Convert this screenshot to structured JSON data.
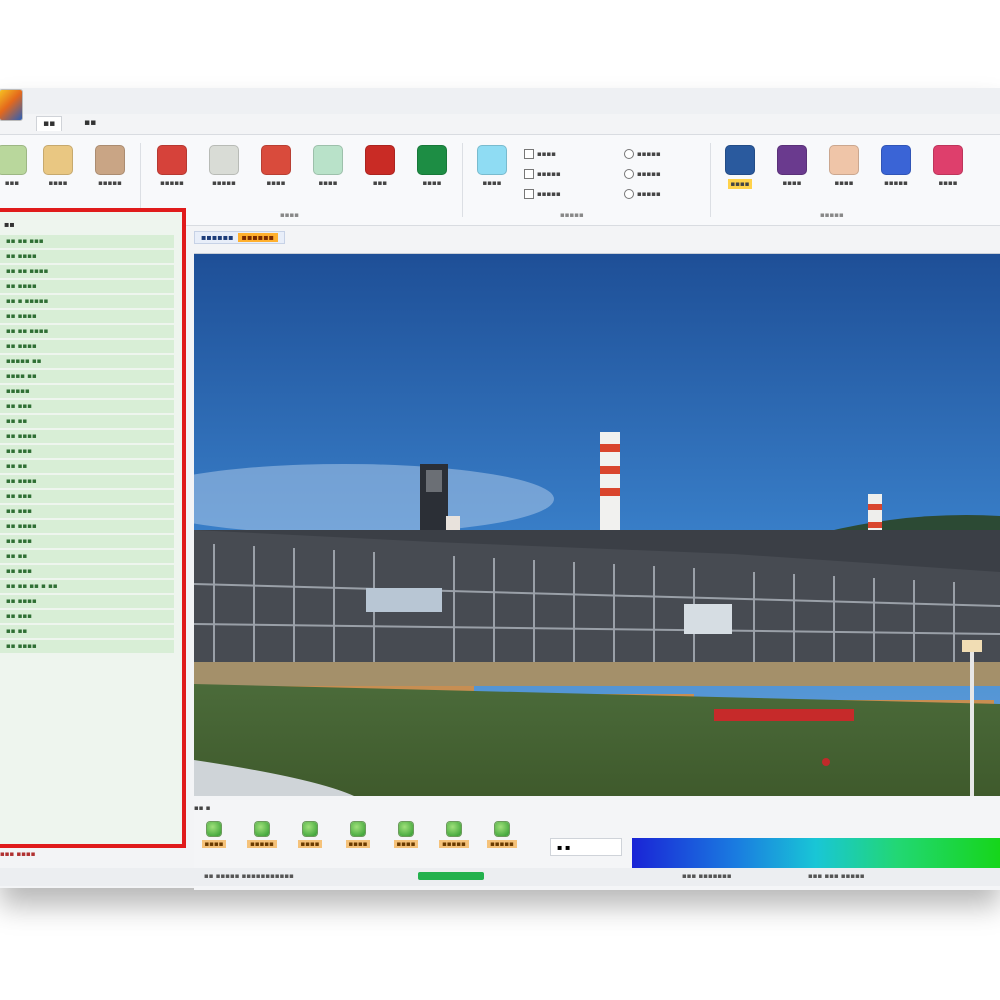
{
  "app": {
    "menu_tabs": [
      {
        "label": "▪▪"
      },
      {
        "label": "▪▪"
      }
    ]
  },
  "ribbon": {
    "buttons": [
      {
        "label": "▪▪▪",
        "color": "#b9d79c",
        "icon": "layer-icon"
      },
      {
        "label": "▪▪▪▪",
        "color": "#e9c782",
        "icon": "image-icon"
      },
      {
        "label": "▪▪▪▪▪",
        "color": "#c9a585",
        "icon": "texture-icon"
      },
      {
        "label": "▪▪▪▪▪",
        "color": "#d6423a",
        "icon": "record-icon"
      },
      {
        "label": "▪▪▪▪▪",
        "color": "#d9dcd6",
        "icon": "pointer-icon"
      },
      {
        "label": "▪▪▪▪",
        "color": "#d94b3c",
        "icon": "video-icon"
      },
      {
        "label": "▪▪▪▪",
        "color": "#b9e2c9",
        "icon": "mask-icon"
      },
      {
        "label": "▪▪▪",
        "color": "#c92b25",
        "icon": "shield-icon"
      },
      {
        "label": "▪▪▪▪",
        "color": "#1d8d44",
        "icon": "refresh-icon"
      },
      {
        "label": "▪▪▪▪",
        "color": "#8fdcf3",
        "icon": "screen-icon"
      }
    ],
    "buttons_right": [
      {
        "label": "▪▪▪▪",
        "color": "#2a5a9e",
        "icon": "search-icon",
        "highlight": true
      },
      {
        "label": "▪▪▪▪",
        "color": "#6a3a8e",
        "icon": "user-icon"
      },
      {
        "label": "▪▪▪▪",
        "color": "#efc5a8",
        "icon": "palette-icon"
      },
      {
        "label": "▪▪▪▪▪",
        "color": "#3a64d6",
        "icon": "square-icon"
      },
      {
        "label": "▪▪▪▪",
        "color": "#de3f6c",
        "icon": "grid-icon"
      }
    ],
    "options": [
      {
        "label": "▪▪▪▪"
      },
      {
        "label": "▪▪▪▪▪"
      },
      {
        "label": "▪▪▪▪▪"
      },
      {
        "label": "▪▪▪▪▪"
      },
      {
        "label": "▪▪▪▪▪"
      },
      {
        "label": "▪▪▪▪▪"
      }
    ],
    "group_labels": [
      "▪▪▪▪",
      "▪▪▪▪▪",
      "▪▪▪▪▪"
    ]
  },
  "tree": {
    "root": "▪▪",
    "items": [
      "▪▪ ▪▪ ▪▪▪",
      "▪▪ ▪▪▪▪",
      "▪▪ ▪▪ ▪▪▪▪",
      "▪▪ ▪▪▪▪",
      "▪▪ ▪ ▪▪▪▪▪",
      "▪▪ ▪▪▪▪",
      "▪▪ ▪▪ ▪▪▪▪",
      "▪▪ ▪▪▪▪",
      "▪▪▪▪▪ ▪▪",
      "▪▪▪▪ ▪▪",
      "▪▪▪▪▪",
      "▪▪ ▪▪▪",
      "▪▪ ▪▪",
      "▪▪ ▪▪▪▪",
      "▪▪ ▪▪▪",
      "▪▪ ▪▪",
      "▪▪ ▪▪▪▪",
      "▪▪ ▪▪▪",
      "▪▪ ▪▪▪",
      "▪▪ ▪▪▪▪",
      "▪▪ ▪▪▪",
      "▪▪ ▪▪",
      "▪▪ ▪▪▪",
      "▪▪ ▪▪ ▪▪ ▪ ▪▪",
      "▪▪ ▪▪▪▪",
      "▪▪ ▪▪▪",
      "▪▪ ▪▪",
      "▪▪ ▪▪▪▪"
    ],
    "footer": "▪▪▪ ▪▪▪▪"
  },
  "viewer": {
    "tab_label": "▪▪▪▪▪▪",
    "tab_warning": "▪▪▪▪▪▪"
  },
  "playback": {
    "section_label": "▪▪ ▪",
    "controls": [
      {
        "label": "▪▪▪▪"
      },
      {
        "label": "▪▪▪▪▪"
      },
      {
        "label": "▪▪▪▪"
      },
      {
        "label": "▪▪▪▪"
      },
      {
        "label": "▪▪▪▪"
      },
      {
        "label": "▪▪▪▪▪"
      },
      {
        "label": "▪▪▪▪▪"
      }
    ],
    "value_box": "▪ ▪"
  },
  "statusbar": {
    "left": "▪▪ ▪▪▪▪▪ ▪▪▪▪▪▪▪▪▪▪▪",
    "right_a": "▪▪▪ ▪▪▪▪▪▪▪",
    "right_b": "▪▪▪ ▪▪▪ ▪▪▪▪▪"
  }
}
